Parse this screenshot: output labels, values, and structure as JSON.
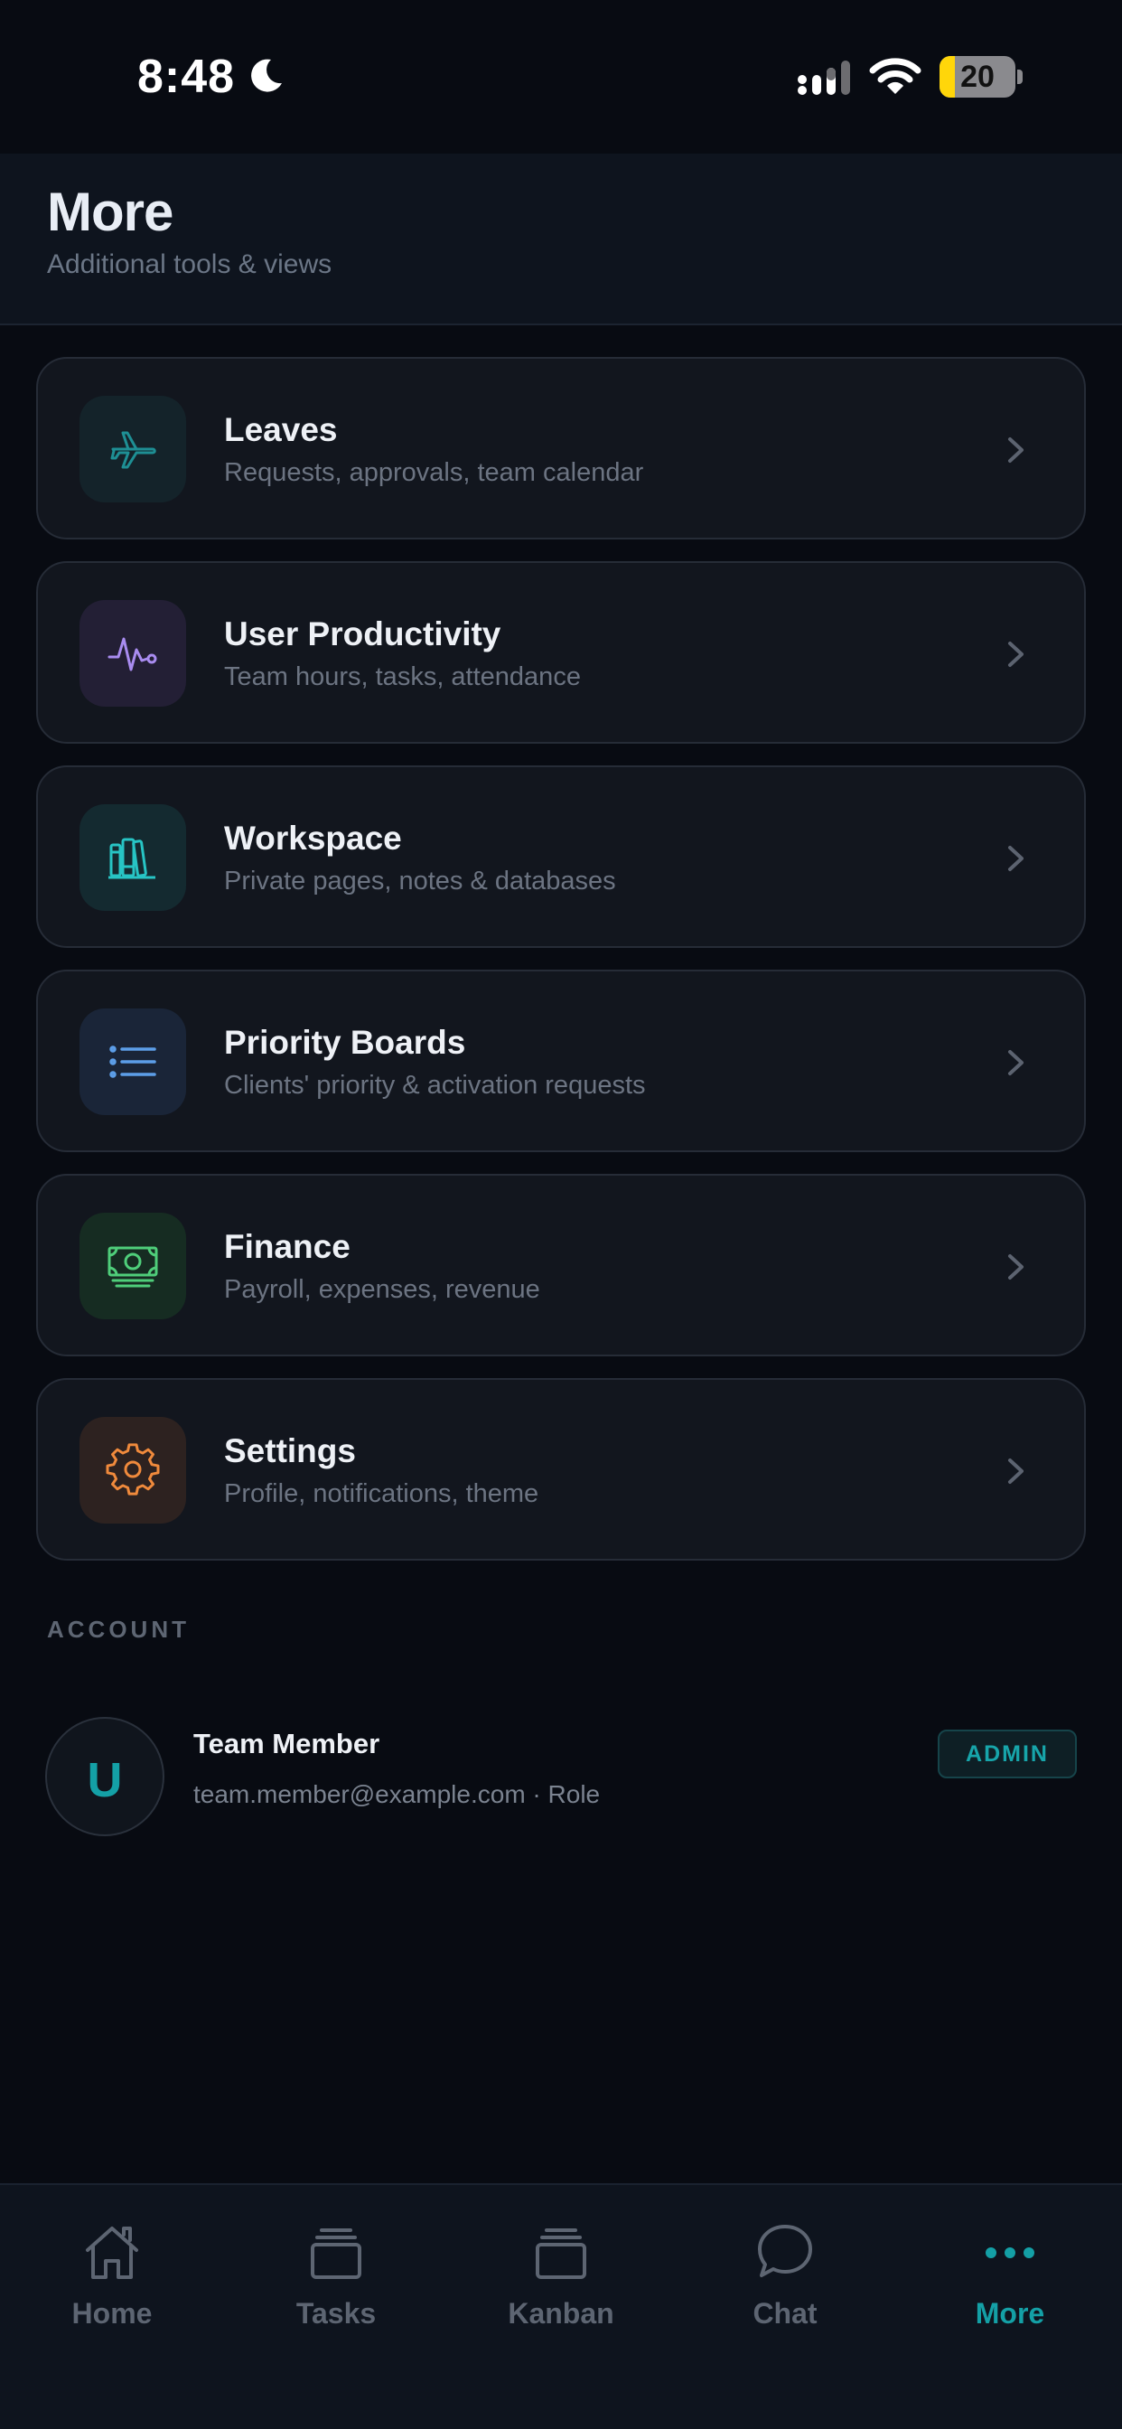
{
  "status_bar": {
    "time": "8:48",
    "battery": "20",
    "battery_level": 0.2
  },
  "header": {
    "title": "More",
    "subtitle": "Additional tools & views"
  },
  "menu": [
    {
      "title": "Leaves",
      "description": "Requests, approvals, team calendar",
      "icon": "airplane-icon",
      "color": "#1e8f94",
      "bg": "#14232a"
    },
    {
      "title": "User Productivity",
      "description": "Team hours, tasks, attendance",
      "icon": "activity-icon",
      "color": "#a98cf0",
      "bg": "#231f35"
    },
    {
      "title": "Workspace",
      "description": "Private pages, notes & databases",
      "icon": "library-icon",
      "color": "#27c4c4",
      "bg": "#142a30"
    },
    {
      "title": "Priority Boards",
      "description": "Clients' priority & activation requests",
      "icon": "list-icon",
      "color": "#5c9ee8",
      "bg": "#1a2538"
    },
    {
      "title": "Finance",
      "description": "Payroll, expenses, revenue",
      "icon": "money-icon",
      "color": "#4fce7a",
      "bg": "#162c22"
    },
    {
      "title": "Settings",
      "description": "Profile, notifications, theme",
      "icon": "gear-icon",
      "color": "#f08a3c",
      "bg": "#2d2220"
    }
  ],
  "account": {
    "section_label": "ACCOUNT",
    "avatar_letter": "U",
    "name": "Team Member",
    "email": "team.member@example.com · Role",
    "role": "ADMIN"
  },
  "tabs": [
    {
      "label": "Home",
      "icon": "home-icon",
      "active": false
    },
    {
      "label": "Tasks",
      "icon": "tasks-icon",
      "active": false
    },
    {
      "label": "Kanban",
      "icon": "kanban-icon",
      "active": false
    },
    {
      "label": "Chat",
      "icon": "chat-icon",
      "active": false
    },
    {
      "label": "More",
      "icon": "more-icon",
      "active": true
    }
  ],
  "colors": {
    "accent": "#14a0a6",
    "background": "#080b12",
    "card": "#12161e"
  }
}
